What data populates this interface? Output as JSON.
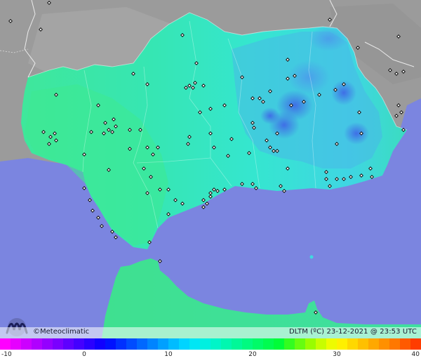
{
  "brand": {
    "copyright": "©",
    "name": "Meteoclimatic",
    "logo_icon": "meteoclimatic-logo-icon"
  },
  "timestamp": {
    "variable": "DLTM (ºC)",
    "date": "23-12-2021",
    "at": "@",
    "time": "23:53 UTC"
  },
  "scale": {
    "labels": [
      "-10",
      "0",
      "10",
      "20",
      "30",
      "40"
    ],
    "colors": [
      "#ff00ff",
      "#e600ff",
      "#cc00ff",
      "#b000ff",
      "#9400ff",
      "#7a00ff",
      "#5e00ff",
      "#4400ff",
      "#2a00ff",
      "#1000ff",
      "#0012ff",
      "#0030ff",
      "#004cff",
      "#0068ff",
      "#0084ff",
      "#00a0ff",
      "#00bcff",
      "#00d4ff",
      "#00e6f4",
      "#00f0e0",
      "#00f5c8",
      "#00f7b0",
      "#00f898",
      "#00fa80",
      "#00fb68",
      "#00fc50",
      "#00fd38",
      "#33fd20",
      "#66fd10",
      "#99fd00",
      "#c8fd00",
      "#eefb00",
      "#fff000",
      "#ffd800",
      "#ffc000",
      "#ffa800",
      "#ff9000",
      "#ff7800",
      "#ff5a00",
      "#ff3c00"
    ]
  },
  "colors": {
    "sea": "#7b85e0",
    "land_outside": "#9a9a9a",
    "region_west": "#3fe79b",
    "region_center": "#35e6c6",
    "region_east": "#40d8e0",
    "cold_spot": "#4a8fe8"
  }
}
